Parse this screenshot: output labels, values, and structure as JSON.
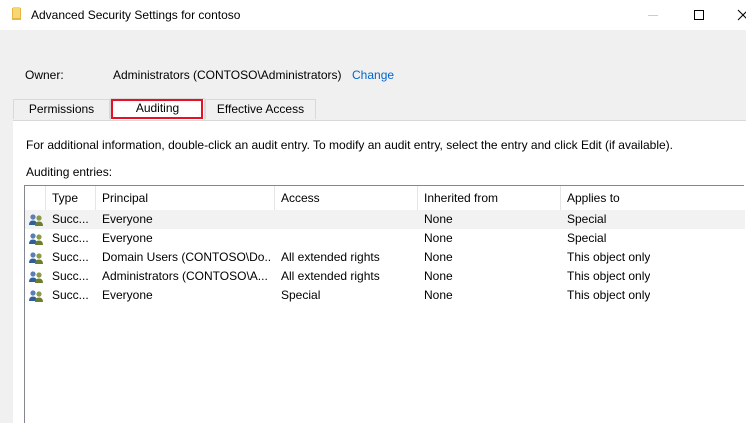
{
  "window": {
    "title": "Advanced Security Settings for contoso",
    "icons": {
      "app": "folder-icon",
      "minimize": "minimize-icon",
      "maximize": "maximize-icon",
      "close": "close-icon"
    }
  },
  "owner": {
    "label": "Owner:",
    "value": "Administrators (CONTOSO\\Administrators)",
    "change_link": "Change"
  },
  "tabs": [
    {
      "label": "Permissions",
      "selected": false
    },
    {
      "label": "Auditing",
      "selected": true
    },
    {
      "label": "Effective Access",
      "selected": false
    }
  ],
  "auditing": {
    "info_text": "For additional information, double-click an audit entry. To modify an audit entry, select the entry and click Edit (if available).",
    "entries_label": "Auditing entries:",
    "columns": [
      "Type",
      "Principal",
      "Access",
      "Inherited from",
      "Applies to"
    ],
    "rows": [
      {
        "icon": "users-icon",
        "type": "Succ...",
        "principal": "Everyone",
        "access": "",
        "inherited_from": "None",
        "applies_to": "Special"
      },
      {
        "icon": "users-icon",
        "type": "Succ...",
        "principal": "Everyone",
        "access": "",
        "inherited_from": "None",
        "applies_to": "Special"
      },
      {
        "icon": "users-icon",
        "type": "Succ...",
        "principal": "Domain Users (CONTOSO\\Do...",
        "access": "All extended rights",
        "inherited_from": "None",
        "applies_to": "This object only"
      },
      {
        "icon": "users-icon",
        "type": "Succ...",
        "principal": "Administrators (CONTOSO\\A...",
        "access": "All extended rights",
        "inherited_from": "None",
        "applies_to": "This object only"
      },
      {
        "icon": "users-icon",
        "type": "Succ...",
        "principal": "Everyone",
        "access": "Special",
        "inherited_from": "None",
        "applies_to": "This object only"
      }
    ]
  },
  "colors": {
    "link": "#0066cc",
    "highlight": "#e81123",
    "window_bg": "#f0f0f0"
  }
}
